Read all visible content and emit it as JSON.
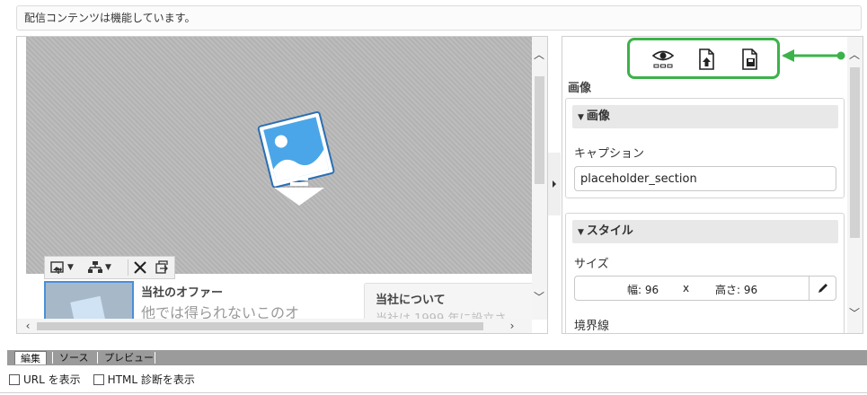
{
  "status": {
    "text": "配信コンテンツは機能しています。"
  },
  "editor": {
    "toolbar": {
      "image_tool_icon": "image-insert-icon",
      "layout_tool_icon": "layout-icon",
      "delete_icon": "close-icon",
      "move_icon": "export-icon"
    },
    "offer": {
      "title": "当社のオファー",
      "subtitle": "他では得られないこのオ"
    },
    "about": {
      "title": "当社について",
      "subtitle": "当社は 1999 年に設立さ"
    }
  },
  "properties": {
    "actions": [
      "eye-icon",
      "upload-doc-icon",
      "save-doc-icon"
    ],
    "title": "画像",
    "image_group": {
      "header": "画像",
      "caption_label": "キャプション",
      "caption_value": "placeholder_section"
    },
    "style_group": {
      "header": "スタイル",
      "size_label": "サイズ",
      "width_text": "幅: 96",
      "x_text": "x",
      "height_text": "高さ: 96",
      "border_label": "境界線"
    }
  },
  "tabs": [
    {
      "label": "編集",
      "active": true
    },
    {
      "label": "ソース",
      "active": false
    },
    {
      "label": "プレビュー",
      "active": false
    }
  ],
  "options": {
    "show_url": "URL を表示",
    "show_html_diag": "HTML 診断を表示"
  },
  "colors": {
    "highlight": "#3cb24a",
    "selection": "#4a8fd9"
  }
}
